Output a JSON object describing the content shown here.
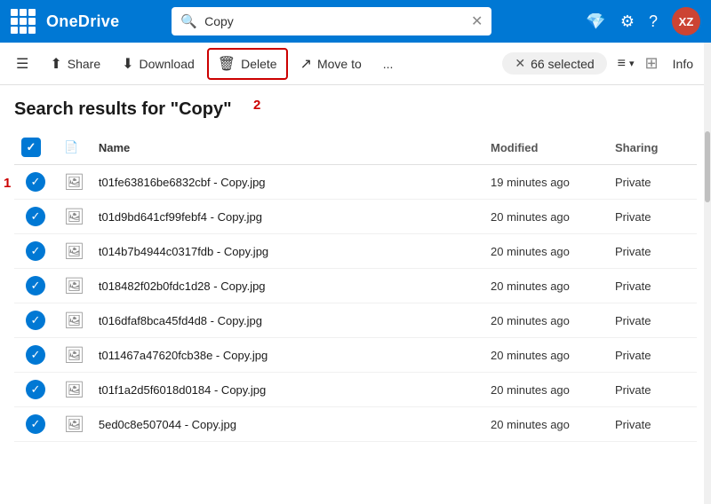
{
  "titlebar": {
    "grid_icon": "apps-icon",
    "brand": "OneDrive",
    "search_placeholder": "Copy",
    "search_value": "Copy",
    "diamond_icon": "diamond-icon",
    "settings_icon": "settings-icon",
    "help_icon": "help-icon",
    "avatar_text": "XZ"
  },
  "toolbar": {
    "hamburger_icon": "menu-icon",
    "share_label": "Share",
    "download_label": "Download",
    "delete_label": "Delete",
    "move_label": "Move to",
    "more_label": "...",
    "selected_count": "66 selected",
    "view_icon": "view-icon",
    "info_label": "Info"
  },
  "search_title": "Search results for \"Copy\"",
  "table": {
    "col_name": "Name",
    "col_modified": "Modified",
    "col_sharing": "Sharing",
    "rows": [
      {
        "name": "t01fe63816be6832cbf - Copy.jpg",
        "modified": "19 minutes ago",
        "sharing": "Private"
      },
      {
        "name": "t01d9bd641cf99febf4 - Copy.jpg",
        "modified": "20 minutes ago",
        "sharing": "Private"
      },
      {
        "name": "t014b7b4944c0317fdb - Copy.jpg",
        "modified": "20 minutes ago",
        "sharing": "Private"
      },
      {
        "name": "t018482f02b0fdc1d28 - Copy.jpg",
        "modified": "20 minutes ago",
        "sharing": "Private"
      },
      {
        "name": "t016dfaf8bca45fd4d8 - Copy.jpg",
        "modified": "20 minutes ago",
        "sharing": "Private"
      },
      {
        "name": "t011467a47620fcb38e - Copy.jpg",
        "modified": "20 minutes ago",
        "sharing": "Private"
      },
      {
        "name": "t01f1a2d5f6018d0184 - Copy.jpg",
        "modified": "20 minutes ago",
        "sharing": "Private"
      },
      {
        "name": "5ed0c8e507044 - Copy.jpg",
        "modified": "20 minutes ago",
        "sharing": "Private"
      }
    ]
  },
  "labels": {
    "label1": "1",
    "label2": "2"
  }
}
